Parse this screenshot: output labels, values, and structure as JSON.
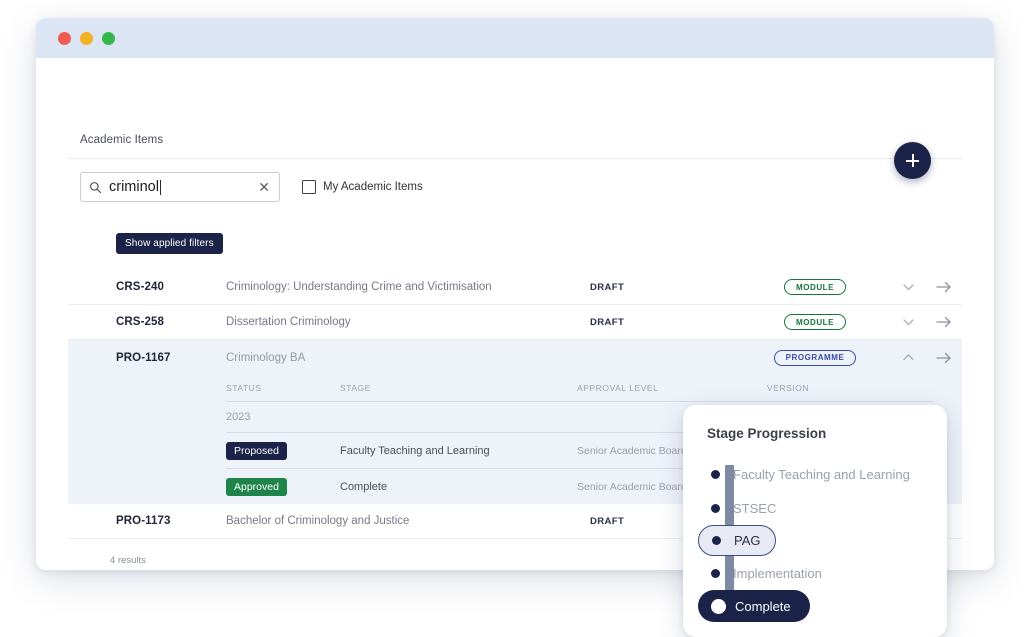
{
  "window": {
    "traffic_lights": [
      "close",
      "minimize",
      "maximize"
    ]
  },
  "header": {
    "title": "Academic Items",
    "add_button_icon": "plus-icon"
  },
  "search": {
    "icon": "search-icon",
    "value": "criminol",
    "clear_icon": "close-icon",
    "my_items_label": "My Academic Items",
    "my_items_checked": false,
    "filters_button_label": "Show applied filters"
  },
  "results": {
    "count_label": "4 results",
    "rows": [
      {
        "code": "CRS-240",
        "title": "Criminology: Understanding Crime and Victimisation",
        "status": "DRAFT",
        "tag": "MODULE",
        "tag_type": "module",
        "chevron": "chevron-down-icon",
        "expanded": false
      },
      {
        "code": "CRS-258",
        "title": "Dissertation Criminology",
        "status": "DRAFT",
        "tag": "MODULE",
        "tag_type": "module",
        "chevron": "chevron-down-icon",
        "expanded": false
      },
      {
        "code": "PRO-1167",
        "title": "Criminology BA",
        "status": "",
        "tag": "PROGRAMME",
        "tag_type": "programme",
        "chevron": "chevron-up-icon",
        "expanded": true
      },
      {
        "code": "PRO-1173",
        "title": "Bachelor of Criminology and Justice",
        "status": "DRAFT",
        "tag": "",
        "tag_type": "",
        "chevron": "",
        "expanded": false
      }
    ]
  },
  "subtable": {
    "columns": {
      "status": "STATUS",
      "stage": "STAGE",
      "approval_level": "APPROVAL LEVEL",
      "version": "VERSION"
    },
    "year": "2023",
    "rows": [
      {
        "status": "Proposed",
        "status_type": "proposed",
        "stage": "Faculty Teaching and Learning",
        "approval_level": "Senior Academic Board"
      },
      {
        "status": "Approved",
        "status_type": "approved",
        "stage": "Complete",
        "approval_level": "Senior Academic Board"
      }
    ]
  },
  "popup": {
    "title": "Stage Progression",
    "steps": [
      {
        "label": "Faculty Teaching and Learning",
        "state": "done"
      },
      {
        "label": "STSEC",
        "state": "done"
      },
      {
        "label": "PAG",
        "state": "current"
      },
      {
        "label": "Implementation",
        "state": "done"
      },
      {
        "label": "Complete",
        "state": "final"
      }
    ]
  },
  "colors": {
    "navy": "#1b2348",
    "green": "#1e8449",
    "module_green": "#14773c",
    "programme_blue": "#3a4aa8",
    "titlebar": "#dbe5f4",
    "expanded_row": "#eef2f9"
  }
}
